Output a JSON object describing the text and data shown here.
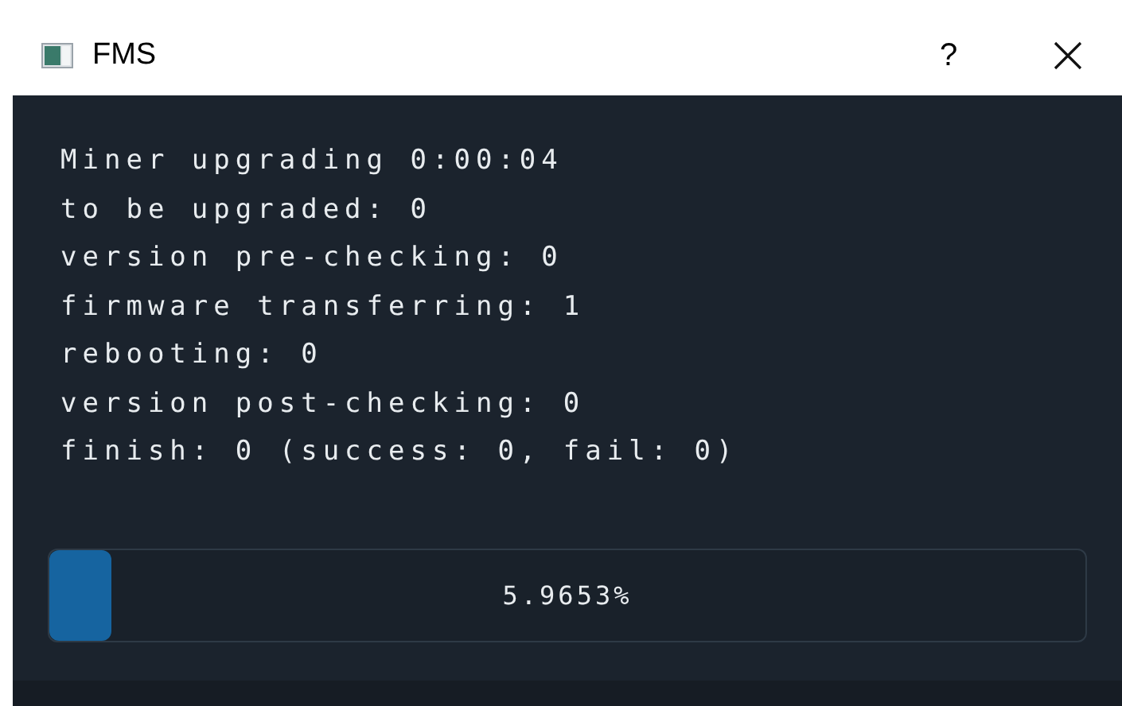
{
  "window": {
    "title": "FMS",
    "help": "?"
  },
  "status_lines": [
    "Miner upgrading 0:00:04",
    "to be upgraded: 0",
    "version pre-checking: 0",
    "firmware transferring: 1",
    "rebooting: 0",
    "version post-checking: 0",
    "finish: 0 (success: 0, fail: 0)"
  ],
  "progress": {
    "level": 0.06,
    "reading": "5.9653%"
  }
}
